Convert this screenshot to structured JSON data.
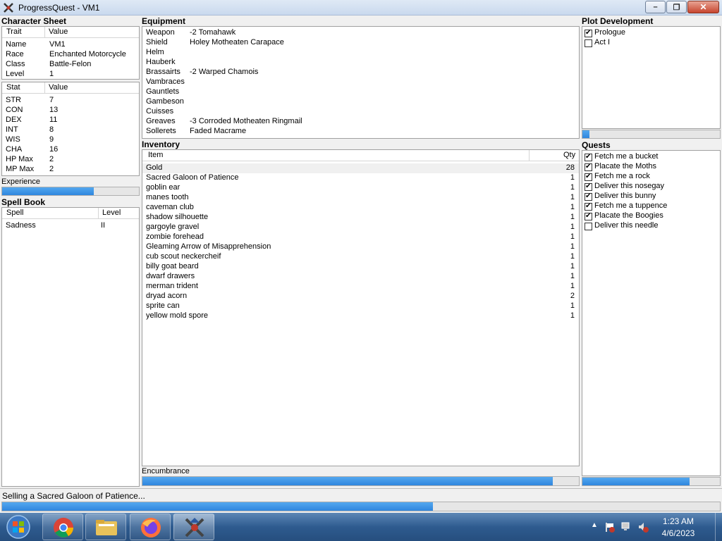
{
  "window": {
    "title": "ProgressQuest - VM1",
    "buttons": {
      "minimize": "–",
      "maximize": "❐",
      "close": "✕"
    }
  },
  "character": {
    "title": "Character Sheet",
    "headers": [
      "Trait",
      "Value"
    ],
    "traits": [
      [
        "Name",
        "VM1"
      ],
      [
        "Race",
        "Enchanted Motorcycle"
      ],
      [
        "Class",
        "Battle-Felon"
      ],
      [
        "Level",
        "1"
      ]
    ],
    "stat_headers": [
      "Stat",
      "Value"
    ],
    "stats": [
      [
        "STR",
        "7"
      ],
      [
        "CON",
        "13"
      ],
      [
        "DEX",
        "11"
      ],
      [
        "INT",
        "8"
      ],
      [
        "WIS",
        "9"
      ],
      [
        "CHA",
        "16"
      ],
      [
        "HP Max",
        "2"
      ],
      [
        "MP Max",
        "2"
      ]
    ],
    "experience_label": "Experience",
    "experience_progress": 0.67
  },
  "spellbook": {
    "title": "Spell Book",
    "headers": [
      "Spell",
      "Level"
    ],
    "spells": [
      [
        "Sadness",
        "II"
      ]
    ]
  },
  "equipment": {
    "title": "Equipment",
    "items": [
      [
        "Weapon",
        "-2 Tomahawk"
      ],
      [
        "Shield",
        "Holey Motheaten Carapace"
      ],
      [
        "Helm",
        ""
      ],
      [
        "Hauberk",
        ""
      ],
      [
        "Brassairts",
        "-2 Warped Chamois"
      ],
      [
        "Vambraces",
        ""
      ],
      [
        "Gauntlets",
        ""
      ],
      [
        "Gambeson",
        ""
      ],
      [
        "Cuisses",
        ""
      ],
      [
        "Greaves",
        "-3 Corroded Motheaten Ringmail"
      ],
      [
        "Sollerets",
        "Faded Macrame"
      ]
    ]
  },
  "inventory": {
    "title": "Inventory",
    "headers": [
      "Item",
      "Qty"
    ],
    "items": [
      [
        "Gold",
        "28"
      ],
      [
        "Sacred Galoon of Patience",
        "1"
      ],
      [
        "goblin ear",
        "1"
      ],
      [
        "manes tooth",
        "1"
      ],
      [
        "caveman club",
        "1"
      ],
      [
        "shadow silhouette",
        "1"
      ],
      [
        "gargoyle gravel",
        "1"
      ],
      [
        "zombie forehead",
        "1"
      ],
      [
        "Gleaming Arrow of Misapprehension",
        "1"
      ],
      [
        "cub scout neckercheif",
        "1"
      ],
      [
        "billy goat beard",
        "1"
      ],
      [
        "dwarf drawers",
        "1"
      ],
      [
        "merman trident",
        "1"
      ],
      [
        "dryad acorn",
        "2"
      ],
      [
        "sprite can",
        "1"
      ],
      [
        "yellow mold spore",
        "1"
      ]
    ],
    "encumbrance_label": "Encumbrance",
    "encumbrance_progress": 0.94
  },
  "plot": {
    "title": "Plot Development",
    "acts": [
      {
        "label": "Prologue",
        "checked": true
      },
      {
        "label": "Act I",
        "checked": false
      }
    ],
    "progress": 0.05
  },
  "quests": {
    "title": "Quests",
    "items": [
      {
        "label": "Fetch me a bucket",
        "checked": true
      },
      {
        "label": "Placate the Moths",
        "checked": true
      },
      {
        "label": "Fetch me a rock",
        "checked": true
      },
      {
        "label": "Deliver this nosegay",
        "checked": true
      },
      {
        "label": "Deliver this bunny",
        "checked": true
      },
      {
        "label": "Fetch me a tuppence",
        "checked": true
      },
      {
        "label": "Placate the Boogies",
        "checked": true
      },
      {
        "label": "Deliver this needle",
        "checked": false
      }
    ],
    "progress": 0.78
  },
  "status": {
    "text": "Selling a Sacred Galoon of Patience...",
    "progress": 0.6
  },
  "taskbar": {
    "clock_time": "1:23 AM",
    "clock_date": "4/6/2023",
    "apps": [
      "start-orb",
      "chrome",
      "file-explorer",
      "firefox",
      "progressquest"
    ]
  },
  "colors": {
    "progress_fill": "#2f86de",
    "title_bar": "#c9d9ee",
    "taskbar": "#2e5b8f"
  }
}
